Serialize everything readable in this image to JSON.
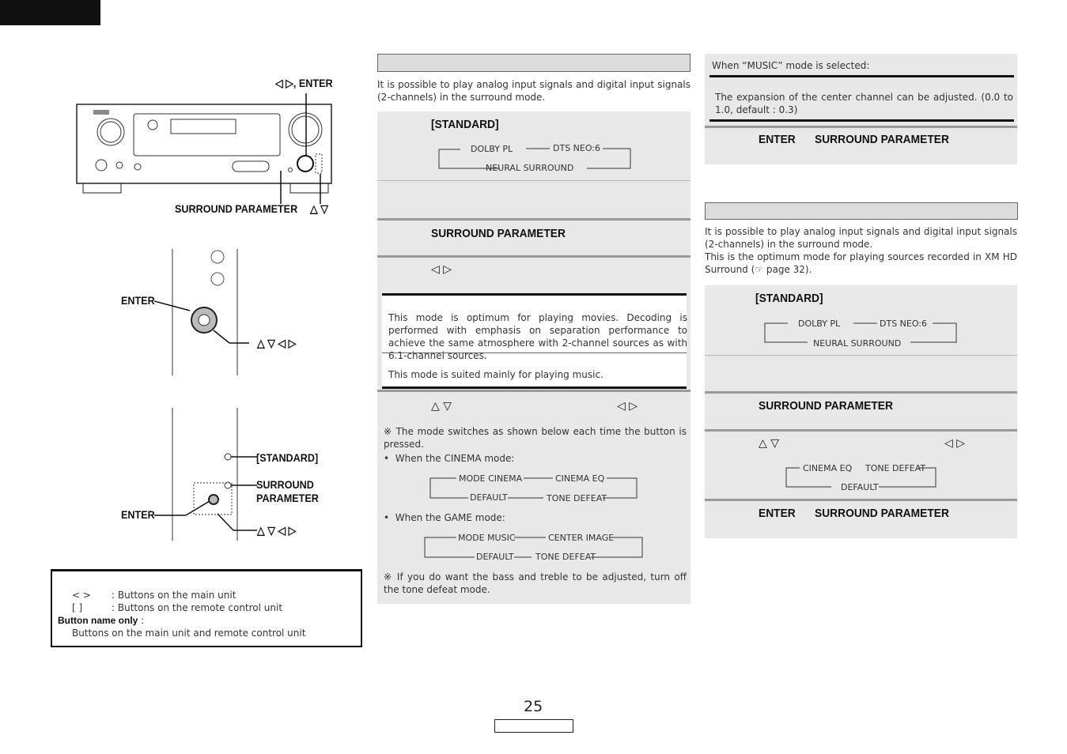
{
  "corner_tab": "",
  "left": {
    "receiver_labels": {
      "top": "◁ ▷, ENTER",
      "bottom_left": "SURROUND PARAMETER",
      "bottom_right": "△ ▽"
    },
    "remote1_labels": {
      "enter": "ENTER",
      "arrows": "△ ▽ ◁ ▷"
    },
    "remote2_labels": {
      "standard": "[STANDARD]",
      "surround": "SURROUND",
      "parameter": "PARAMETER",
      "enter": "ENTER",
      "arrows": "△ ▽ ◁ ▷"
    },
    "legend": {
      "row1_key": "<      >",
      "row1": ": Buttons on the main unit",
      "row2_key": "[      ]",
      "row2": ": Buttons on the remote control unit",
      "row3_key": "Button name only",
      "row3_colon": " :",
      "row4": "Buttons on the main unit and remote control unit"
    }
  },
  "middle": {
    "intro": "It is possible to play analog input signals and digital input signals (2-channels) in the surround mode.",
    "standard": "[STANDARD]",
    "flow1": {
      "a": "DOLBY PL",
      "b": "DTS NEO:6",
      "c": "NEURAL SURROUND"
    },
    "surround_parameter": "SURROUND PARAMETER",
    "lr_arrows": "◁ ▷",
    "cinema_desc": "This mode is optimum for playing movies. Decoding is performed with emphasis on separation performance to achieve the same atmosphere with 2-channel sources as with 6.1-channel sources.",
    "music_desc": "This mode is suited mainly for playing music.",
    "ud_arrows": "△ ▽",
    "note1": "The mode switches as shown below each time the button is pressed.",
    "cinema_label": "When the CINEMA mode:",
    "cinema_flow": {
      "a": "MODE CINEMA",
      "b": "CINEMA EQ",
      "c": "DEFAULT",
      "d": "TONE DEFEAT"
    },
    "game_label": "When the GAME mode:",
    "game_flow": {
      "a": "MODE MUSIC",
      "b": "CENTER IMAGE",
      "c": "DEFAULT",
      "d": "TONE DEFEAT"
    },
    "note2": "If you do want the bass and treble to be adjusted, turn off the tone defeat mode.",
    "note_mark": "※",
    "bullet": "•"
  },
  "right": {
    "music_selected": "When “MUSIC” mode is selected:",
    "center_desc": "The expansion of the center channel can be adjusted. (0.0 to 1.0, default : 0.3)",
    "enter": "ENTER",
    "surround_parameter": "SURROUND PARAMETER",
    "intro": "It is possible to play analog input signals and digital input signals (2-channels) in the surround mode.",
    "intro2": "This is the optimum mode for playing sources recorded in XM HD Surround (☞ page 32).",
    "standard": "[STANDARD]",
    "flow1": {
      "a": "DOLBY PL",
      "b": "DTS NEO:6",
      "c": "NEURAL SURROUND"
    },
    "ud_arrows": "△ ▽",
    "lr_arrows": "◁ ▷",
    "flow2": {
      "a": "CINEMA EQ",
      "b": "TONE DEFEAT",
      "c": "DEFAULT"
    }
  },
  "footer": {
    "page_number": "25"
  }
}
